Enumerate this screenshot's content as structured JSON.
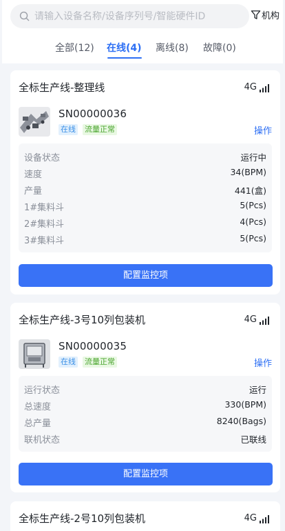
{
  "search": {
    "placeholder": "请输入设备名称/设备序列号/智能硬件ID",
    "value": ""
  },
  "org_button": {
    "label": "机构",
    "icon": "filter-icon"
  },
  "tabs": [
    {
      "label": "全部(12)",
      "active": false
    },
    {
      "label": "在线(4)",
      "active": true
    },
    {
      "label": "离线(8)",
      "active": false
    },
    {
      "label": "故障(0)",
      "active": false
    }
  ],
  "colors": {
    "accent": "#2d6ff4",
    "button": "#3972f6",
    "online_badge": "#3a8fe6",
    "flow_badge": "#4aa52e"
  },
  "cards": [
    {
      "title": "全标生产线-整理线",
      "network": "4G",
      "sn": "SN00000036",
      "badges": {
        "online": "在线",
        "flow": "流量正常"
      },
      "op_label": "操作",
      "metrics": [
        {
          "label": "设备状态",
          "value": "运行中"
        },
        {
          "label": "速度",
          "value": "34(BPM)"
        },
        {
          "label": "产量",
          "value": "441(盒)"
        },
        {
          "label": "1#集料斗",
          "value": "5(Pcs)"
        },
        {
          "label": "2#集料斗",
          "value": "4(Pcs)"
        },
        {
          "label": "3#集料斗",
          "value": "5(Pcs)"
        }
      ],
      "config_label": "配置监控项"
    },
    {
      "title": "全标生产线-3号10列包装机",
      "network": "4G",
      "sn": "SN00000035",
      "badges": {
        "online": "在线",
        "flow": "流量正常"
      },
      "op_label": "操作",
      "metrics": [
        {
          "label": "运行状态",
          "value": "运行"
        },
        {
          "label": "总速度",
          "value": "330(BPM)"
        },
        {
          "label": "总产量",
          "value": "8240(Bags)"
        },
        {
          "label": "联机状态",
          "value": "已联线"
        }
      ],
      "config_label": "配置监控项"
    },
    {
      "title": "全标生产线-2号10列包装机",
      "network": "4G"
    }
  ]
}
